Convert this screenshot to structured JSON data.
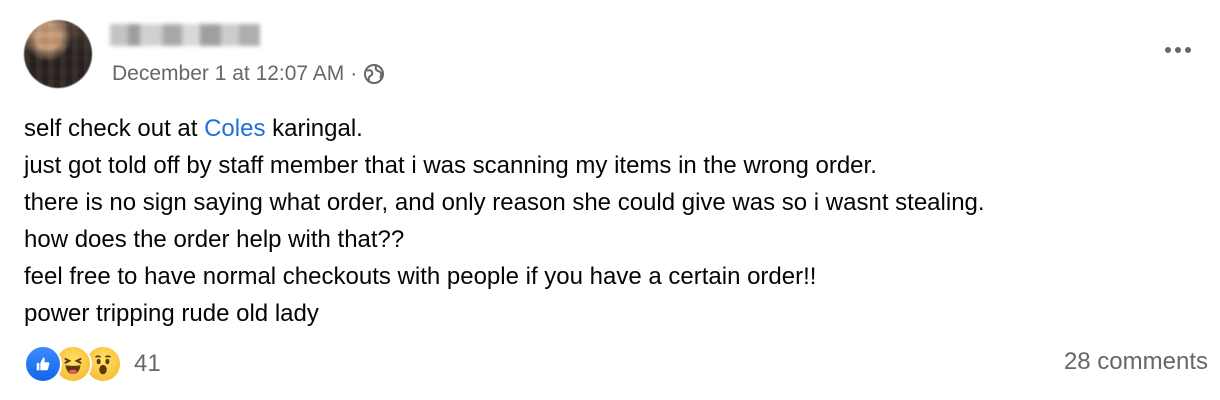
{
  "post": {
    "author_name": "",
    "timestamp": "December 1 at 12:07 AM",
    "separator": "·",
    "audience_icon": "globe-icon",
    "more_icon": "more-horizontal-icon",
    "lines": [
      {
        "before": "self check out at ",
        "mention": "Coles",
        "after": " karingal."
      },
      {
        "text": "just got told off by staff member that i was scanning my items in the wrong order."
      },
      {
        "text": "there is no sign saying what order, and only reason she could give was so i wasnt stealing."
      },
      {
        "text": "how does the order help with that??"
      },
      {
        "text": "feel free to have normal checkouts with people if you have a certain order!!"
      },
      {
        "text": "power tripping rude old lady"
      }
    ],
    "mention_color": "#216fdb"
  },
  "footer": {
    "reaction_icons": [
      "like-icon",
      "haha-icon",
      "wow-icon"
    ],
    "reaction_count": "41",
    "comments": "28 comments"
  }
}
